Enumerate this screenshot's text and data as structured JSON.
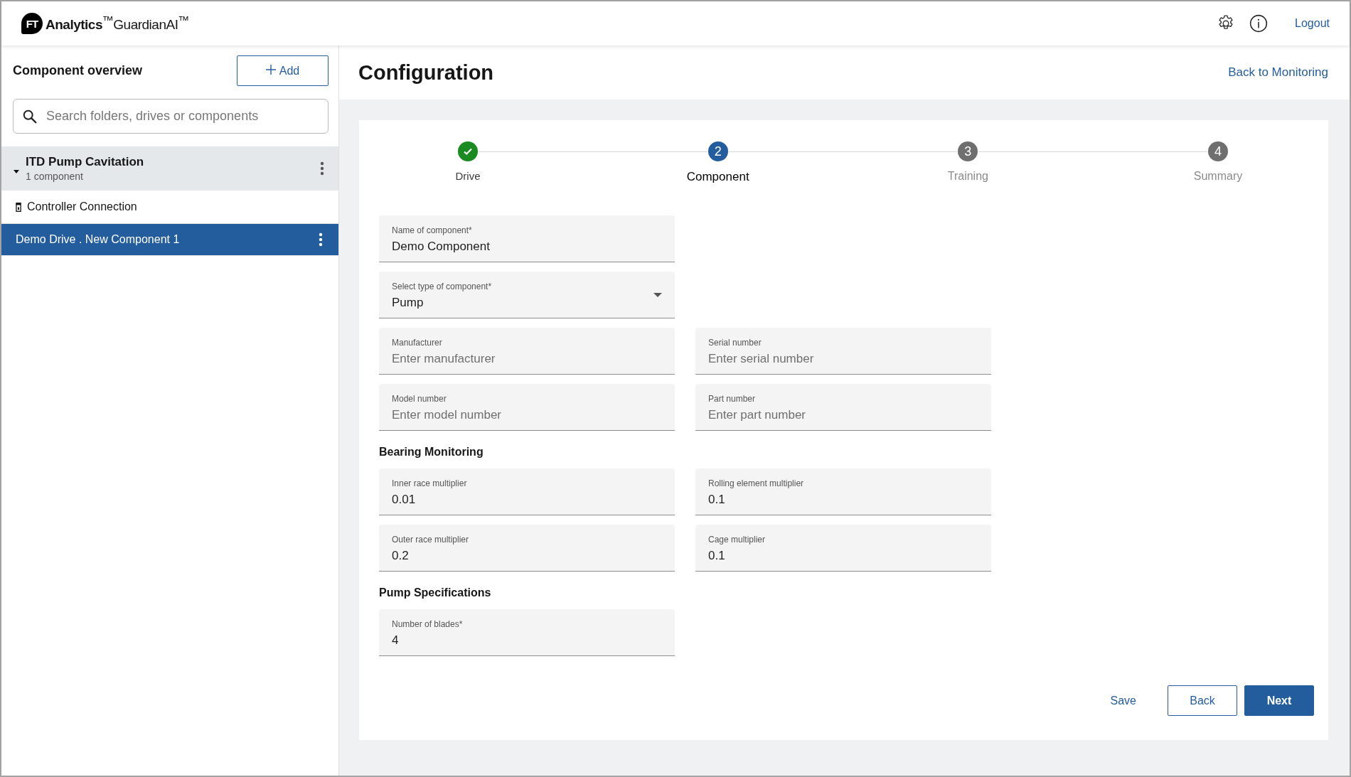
{
  "header": {
    "logo_mark": "FT",
    "logo_text": "**Analytics**$^{™}$GuardianAI$^{™}$",
    "logout": "Logout"
  },
  "sidebar": {
    "title": "Component overview",
    "add_button": "Add",
    "search": {
      "placeholder": "Search folders, drives or components"
    },
    "tree": [
      {
        "name": "ITD Pump Cavitation",
        "subtitle": "1 component",
        "expanded": true,
        "selected": false,
        "children": [
          {
            "label": "Controller Connection",
            "kind": "controller",
            "selected": false
          },
          {
            "label": "Demo Drive . New Component 1",
            "kind": "component",
            "selected": true
          }
        ]
      }
    ]
  },
  "main": {
    "title": "Configuration",
    "back_link": "Back to Monitoring",
    "steps": [
      {
        "label": "Drive",
        "completed": true,
        "selected": false
      },
      {
        "number": "2",
        "label": "Component",
        "completed": false,
        "selected": true
      },
      {
        "number": "3",
        "label": "Training",
        "completed": false,
        "selected": false
      },
      {
        "number": "4",
        "label": "Summary",
        "completed": false,
        "selected": false
      }
    ],
    "sections": [
      {
        "rows": [
          [
            {
              "kind": "text",
              "label": "Name of component*",
              "value": "Demo Component"
            }
          ],
          [
            {
              "kind": "select",
              "label": "Select type of component*",
              "value": "Pump"
            }
          ],
          [
            {
              "kind": "text",
              "label": "Manufacturer",
              "placeholder": "Enter manufacturer"
            },
            {
              "kind": "text",
              "label": "Serial number",
              "placeholder": "Enter serial number"
            }
          ],
          [
            {
              "kind": "text",
              "label": "Model number",
              "placeholder": "Enter model number"
            },
            {
              "kind": "text",
              "label": "Part number",
              "placeholder": "Enter part number"
            }
          ]
        ]
      },
      {
        "title": "Bearing Monitoring",
        "rows": [
          [
            {
              "kind": "text",
              "label": "Inner race multiplier",
              "value": "0.01"
            },
            {
              "kind": "text",
              "label": "Rolling element multiplier",
              "value": "0.1"
            }
          ],
          [
            {
              "kind": "text",
              "label": "Outer race multiplier",
              "value": "0.2"
            },
            {
              "kind": "text",
              "label": "Cage multiplier",
              "value": "0.1"
            }
          ]
        ]
      },
      {
        "title": "Pump Specifications",
        "rows": [
          [
            {
              "kind": "text",
              "label": "Number of blades*",
              "value": "4"
            }
          ]
        ]
      }
    ],
    "buttons": {
      "save": "Save",
      "back": "Back",
      "next": "Next"
    }
  }
}
